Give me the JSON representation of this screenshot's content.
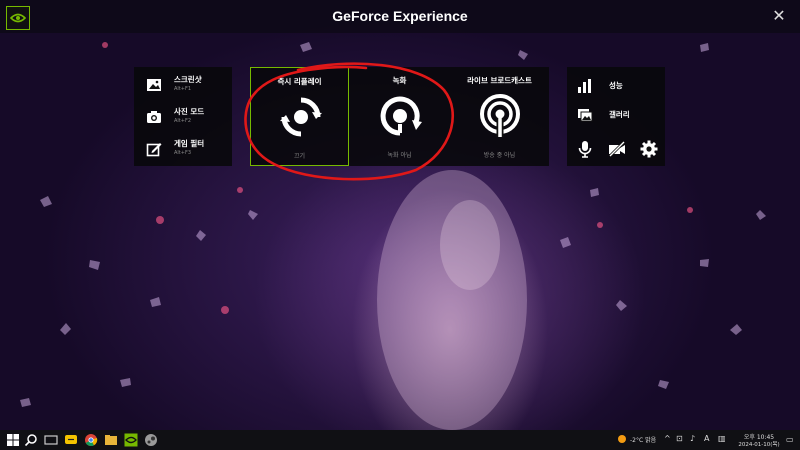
{
  "app": {
    "title": "GeForce Experience",
    "accent": "#76b900"
  },
  "left_menu": [
    {
      "label": "스크린샷",
      "shortcut": "Alt+F1",
      "icon": "image-icon"
    },
    {
      "label": "사진 모드",
      "shortcut": "Alt+F2",
      "icon": "camera-icon"
    },
    {
      "label": "게임 필터",
      "shortcut": "Alt+F3",
      "icon": "filter-edit-icon"
    }
  ],
  "center": [
    {
      "title": "즉시 리플레이",
      "status": "끄기",
      "icon": "instant-replay-icon",
      "selected": true
    },
    {
      "title": "녹화",
      "status": "녹화 아님",
      "icon": "record-icon"
    },
    {
      "title": "라이브 브로드캐스트",
      "status": "방송 중 아님",
      "icon": "broadcast-icon"
    }
  ],
  "right_menu": [
    {
      "label": "성능",
      "icon": "performance-icon"
    },
    {
      "label": "갤러리",
      "icon": "gallery-icon"
    }
  ],
  "right_bottom_icons": [
    "microphone-icon",
    "camera-off-icon",
    "settings-gear-icon"
  ],
  "annotation": {
    "color": "#e01818",
    "shape": "hand-drawn ellipse around replay and record"
  },
  "taskbar": {
    "icons": [
      "windows-start-icon",
      "search-icon",
      "task-view-icon",
      "chat-icon",
      "chrome-icon",
      "file-explorer-icon",
      "nvidia-icon",
      "steam-icon"
    ],
    "weather_temp": "-2°C 맑음",
    "tray_symbols": [
      "^",
      "⊡",
      "♪",
      "A",
      "▥"
    ],
    "time": "오후 10:45",
    "date": "2024-01-10(목)"
  }
}
